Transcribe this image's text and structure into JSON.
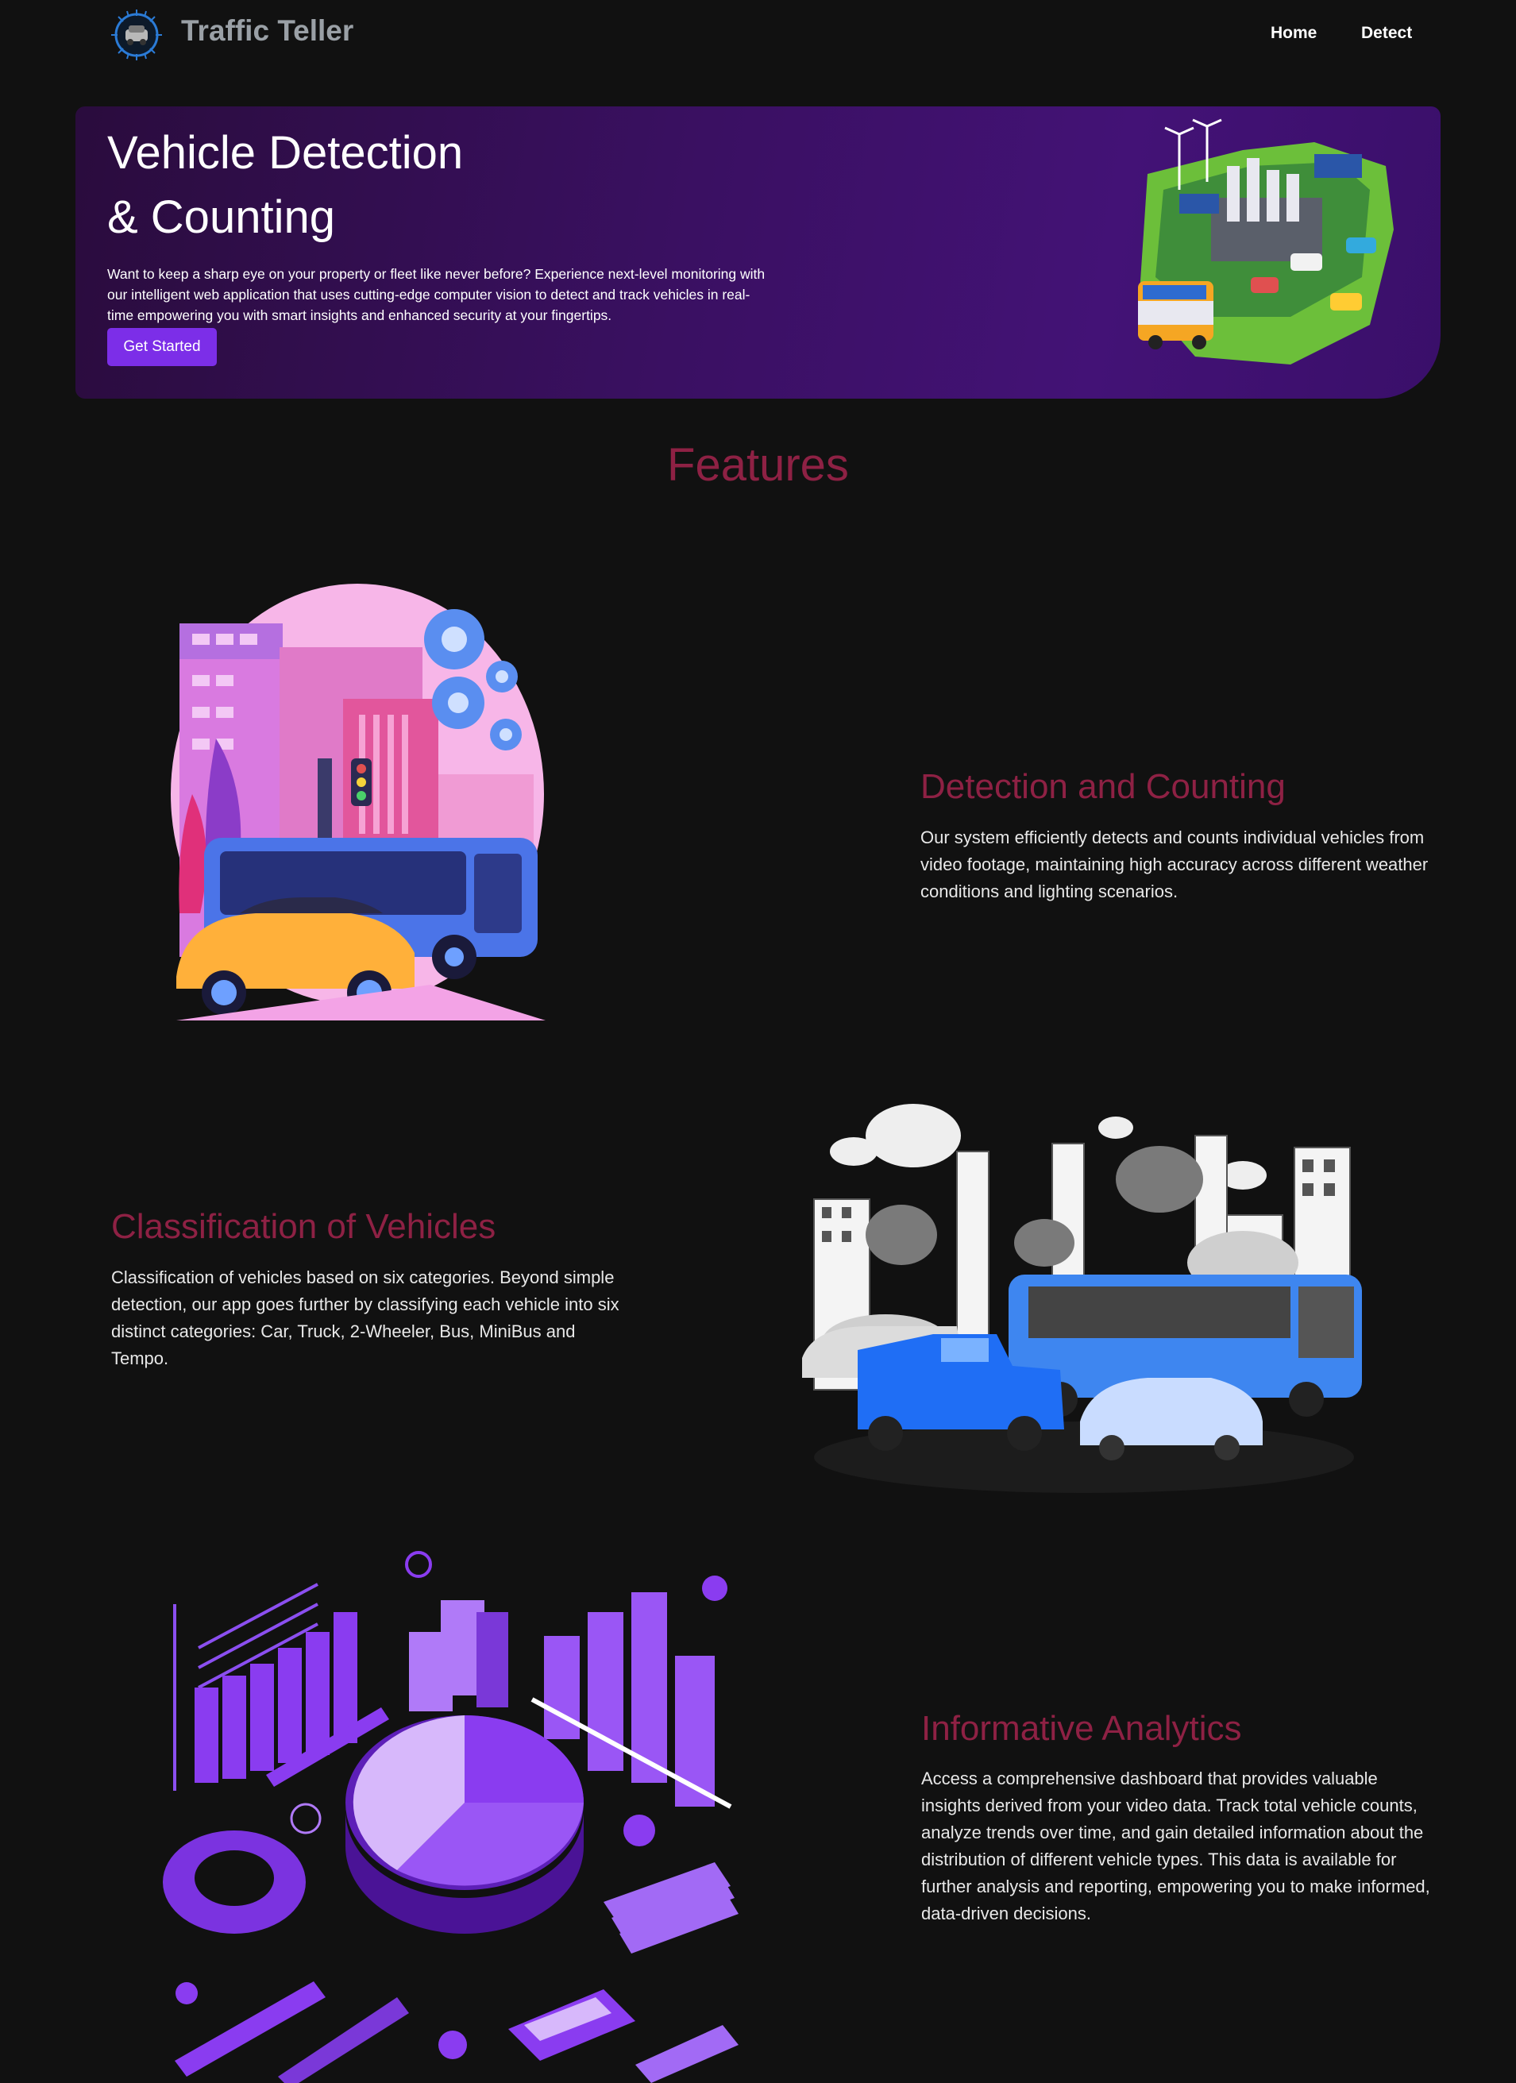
{
  "nav": {
    "brand": "Traffic Teller",
    "links": [
      "Home",
      "Detect"
    ]
  },
  "hero": {
    "title_line1": "Vehicle Detection",
    "title_line2": "& Counting",
    "description": "Want to keep a sharp eye on your property or fleet like never before? Experience next-level monitoring with our intelligent web application that uses cutting-edge computer vision to detect and track vehicles in real-time empowering you with smart insights and enhanced security at your fingertips.",
    "button_label": "Get Started"
  },
  "features": {
    "title": "Features",
    "items": [
      {
        "heading": "Detection and Counting",
        "text": "Our system efficiently detects and counts individual vehicles from video footage, maintaining high accuracy across different weather conditions and lighting scenarios."
      },
      {
        "heading": "Classification of Vehicles",
        "text": "Classification of vehicles based on six categories. Beyond simple detection, our app goes further by classifying each vehicle into six distinct categories: Car, Truck, 2-Wheeler, Bus, MiniBus and Tempo."
      },
      {
        "heading": "Informative Analytics",
        "text": "Access a comprehensive dashboard that provides valuable insights derived from your video data. Track total vehicle counts, analyze trends over time, and gain detailed information about the distribution of different vehicle types. This data is available for further analysis and reporting, empowering you to make informed, data-driven decisions."
      }
    ]
  },
  "colors": {
    "background": "#111111",
    "accent_heading": "#8e2144",
    "button": "#7c2ee8",
    "hero_gradient_start": "#2a0c3d",
    "hero_gradient_end": "#431276"
  },
  "icons": [
    "logo-chip-car-icon"
  ]
}
